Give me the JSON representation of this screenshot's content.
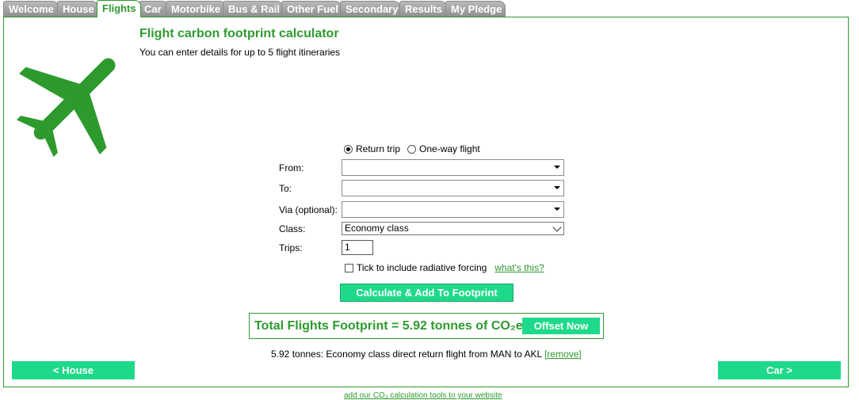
{
  "tabs": [
    "Welcome",
    "House",
    "Flights",
    "Car",
    "Motorbike",
    "Bus & Rail",
    "Other Fuel",
    "Secondary",
    "Results",
    "My Pledge"
  ],
  "active_tab": "Flights",
  "icon": "airplane-icon",
  "colors": {
    "brand_green": "#2e9a2e",
    "button_green": "#1fd98a",
    "tab_grey": "#a0a0a0"
  },
  "header": {
    "title": "Flight carbon footprint calculator",
    "subtitle": "You can enter details for up to 5 flight itineraries"
  },
  "form": {
    "trip_type": {
      "return_label": "Return trip",
      "oneway_label": "One-way flight",
      "selected": "Return trip"
    },
    "from_label": "From:",
    "from_value": "",
    "to_label": "To:",
    "to_value": "",
    "via_label": "Via (optional):",
    "via_value": "",
    "class_label": "Class:",
    "class_value": "Economy class",
    "trips_label": "Trips:",
    "trips_value": "1",
    "radiative_label": "Tick to include radiative forcing",
    "radiative_checked": false,
    "whats_this": "what's this?",
    "calculate_label": "Calculate & Add To Footprint"
  },
  "total": {
    "text": "Total Flights Footprint = 5.92 tonnes of CO₂e",
    "offset_label": "Offset Now"
  },
  "summary": {
    "text": "5.92 tonnes: Economy class direct return flight from MAN to AKL",
    "remove_label": "[remove]"
  },
  "nav": {
    "prev_label": "< House",
    "next_label": "Car >"
  },
  "footer": {
    "text": "add our CO₂ calculation tools to your website"
  }
}
